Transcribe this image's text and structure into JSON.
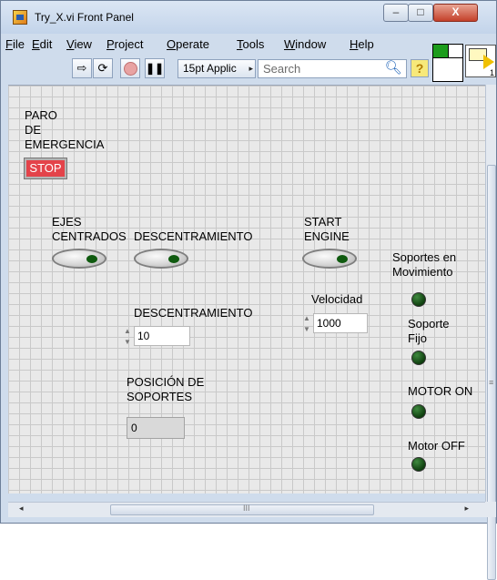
{
  "window": {
    "title": "Try_X.vi Front Panel",
    "controls": {
      "minimize": "–",
      "maximize": "□",
      "close": "X"
    }
  },
  "menu": [
    {
      "label": "File",
      "u": "F",
      "rest": "ile"
    },
    {
      "label": "Edit",
      "u": "E",
      "rest": "dit"
    },
    {
      "label": "View",
      "u": "V",
      "rest": "iew"
    },
    {
      "label": "Project",
      "u": "P",
      "rest": "roject"
    },
    {
      "label": "Operate",
      "u": "O",
      "rest": "perate"
    },
    {
      "label": "Tools",
      "u": "T",
      "rest": "ools"
    },
    {
      "label": "Window",
      "u": "W",
      "rest": "indow"
    },
    {
      "label": "Help",
      "u": "H",
      "rest": "elp"
    }
  ],
  "toolbar": {
    "run_icon": "run-arrow-icon",
    "run_continuous_icon": "run-continuously-icon",
    "abort_icon": "abort-icon",
    "pause_icon": "pause-icon",
    "font_select": "15pt Applic",
    "search_placeholder": "Search",
    "help": "?"
  },
  "panel": {
    "emergency_label": "PARO\nDE\nEMERGENCIA",
    "stop_button": "STOP",
    "ejes_label": "EJES\nCENTRADOS",
    "descentramiento_toggle_label": "DESCENTRAMIENTO",
    "start_label": "START\nENGINE",
    "soportes_mov_label": "Soportes en\nMovimiento",
    "velocidad_label": "Velocidad",
    "velocidad_value": "1000",
    "descentramiento_num_label": "DESCENTRAMIENTO",
    "descentramiento_value": "10",
    "soporte_fijo_label": "Soporte\nFijo",
    "posicion_label": "POSICIÓN DE\nSOPORTES",
    "posicion_value": "0",
    "motor_on_label": "MOTOR ON",
    "motor_off_label": "Motor OFF"
  },
  "scrollbar": {
    "grip": "≡",
    "hgrip": "III"
  },
  "colors": {
    "stop_button": "#e4434a",
    "led_dark_green": "#0f3f0f",
    "grid_bg": "#e9e9e9"
  }
}
